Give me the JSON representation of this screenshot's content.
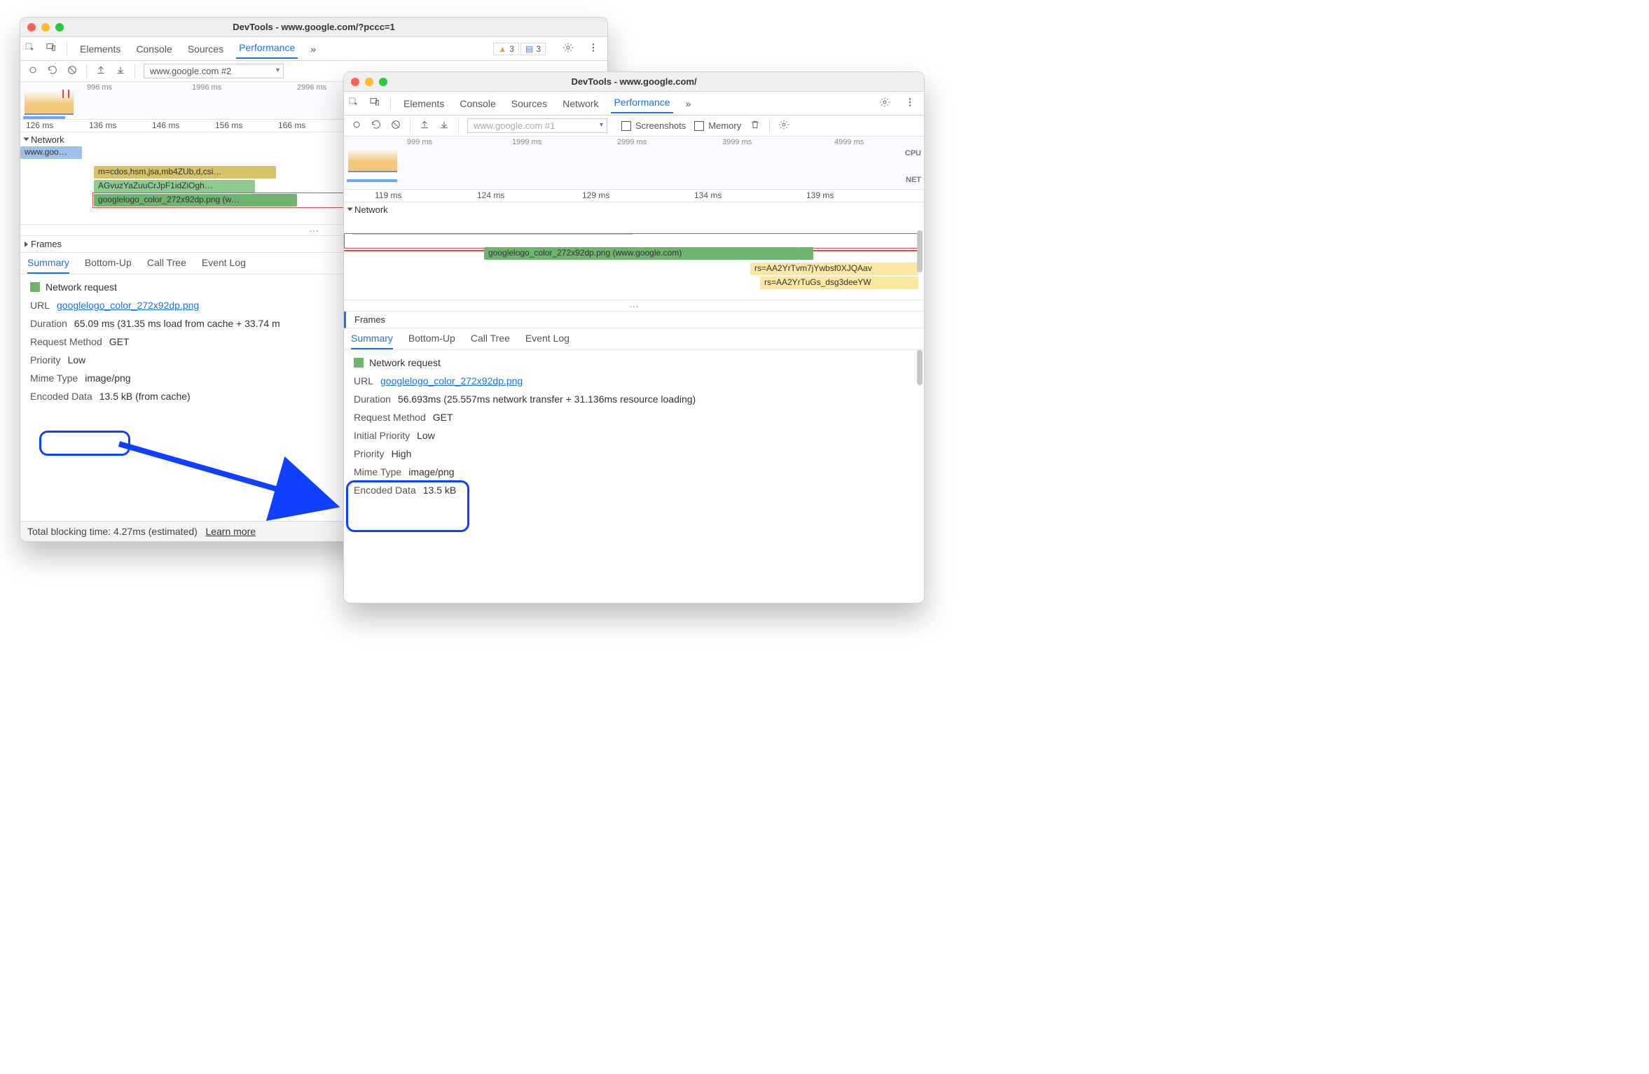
{
  "win1": {
    "title": "DevTools - www.google.com/?pccc=1",
    "tabs": [
      "Elements",
      "Console",
      "Sources",
      "Performance"
    ],
    "active_tab": "Performance",
    "more_tabs_glyph": "»",
    "warnings_count": "3",
    "messages_count": "3",
    "recording_dropdown": "www.google.com #2",
    "timeline_marks": [
      "996 ms",
      "1996 ms",
      "2996 ms"
    ],
    "ruler": [
      "126 ms",
      "136 ms",
      "146 ms",
      "156 ms",
      "166 ms"
    ],
    "network_label": "Network",
    "frames_label": "Frames",
    "lane_bars": {
      "b0": "www.goo…",
      "b1": "m=cdos,hsm,jsa,mb4ZUb,d,csi…",
      "b2": "AGvuzYaZuuCrJpF1idZiOgh…",
      "b3": "googlelogo_color_272x92dp.png (w…"
    },
    "sub_tabs": [
      "Summary",
      "Bottom-Up",
      "Call Tree",
      "Event Log"
    ],
    "active_sub": "Summary",
    "section_title": "Network request",
    "detail": {
      "url_label": "URL",
      "url": "googlelogo_color_272x92dp.png",
      "dur_label": "Duration",
      "dur": "65.09 ms (31.35 ms load from cache + 33.74 m",
      "method_label": "Request Method",
      "method": "GET",
      "priority_label": "Priority",
      "priority": "Low",
      "mime_label": "Mime Type",
      "mime": "image/png",
      "enc_label": "Encoded Data",
      "enc": "13.5 kB (from cache)"
    },
    "footer": {
      "text": "Total blocking time: 4.27ms (estimated)",
      "link": "Learn more"
    }
  },
  "win2": {
    "title": "DevTools - www.google.com/",
    "tabs": [
      "Elements",
      "Console",
      "Sources",
      "Network",
      "Performance"
    ],
    "active_tab": "Performance",
    "more_tabs_glyph": "»",
    "recording_dropdown": "www.google.com #1",
    "chk_screenshots": "Screenshots",
    "chk_memory": "Memory",
    "timeline_marks": [
      "999 ms",
      "1999 ms",
      "2999 ms",
      "3999 ms",
      "4999 ms"
    ],
    "cpu_label": "CPU",
    "net_label": "NET",
    "ruler": [
      "119 ms",
      "124 ms",
      "129 ms",
      "134 ms",
      "139 ms"
    ],
    "network_label": "Network",
    "frames_label": "Frames",
    "lane_bars": {
      "b0": "googlelogo_color_272x92dp.png (www.google.com)",
      "b1": "rs=AA2YrTvm7jYwbsf0XJQAav",
      "b2": "rs=AA2YrTuGs_dsg3deeYW"
    },
    "sub_tabs": [
      "Summary",
      "Bottom-Up",
      "Call Tree",
      "Event Log"
    ],
    "active_sub": "Summary",
    "section_title": "Network request",
    "detail": {
      "url_label": "URL",
      "url": "googlelogo_color_272x92dp.png",
      "dur_label": "Duration",
      "dur": "56.693ms (25.557ms network transfer + 31.136ms resource loading)",
      "method_label": "Request Method",
      "method": "GET",
      "init_priority_label": "Initial Priority",
      "init_priority": "Low",
      "priority_label": "Priority",
      "priority": "High",
      "mime_label": "Mime Type",
      "mime": "image/png",
      "enc_label": "Encoded Data",
      "enc": "13.5 kB"
    }
  }
}
